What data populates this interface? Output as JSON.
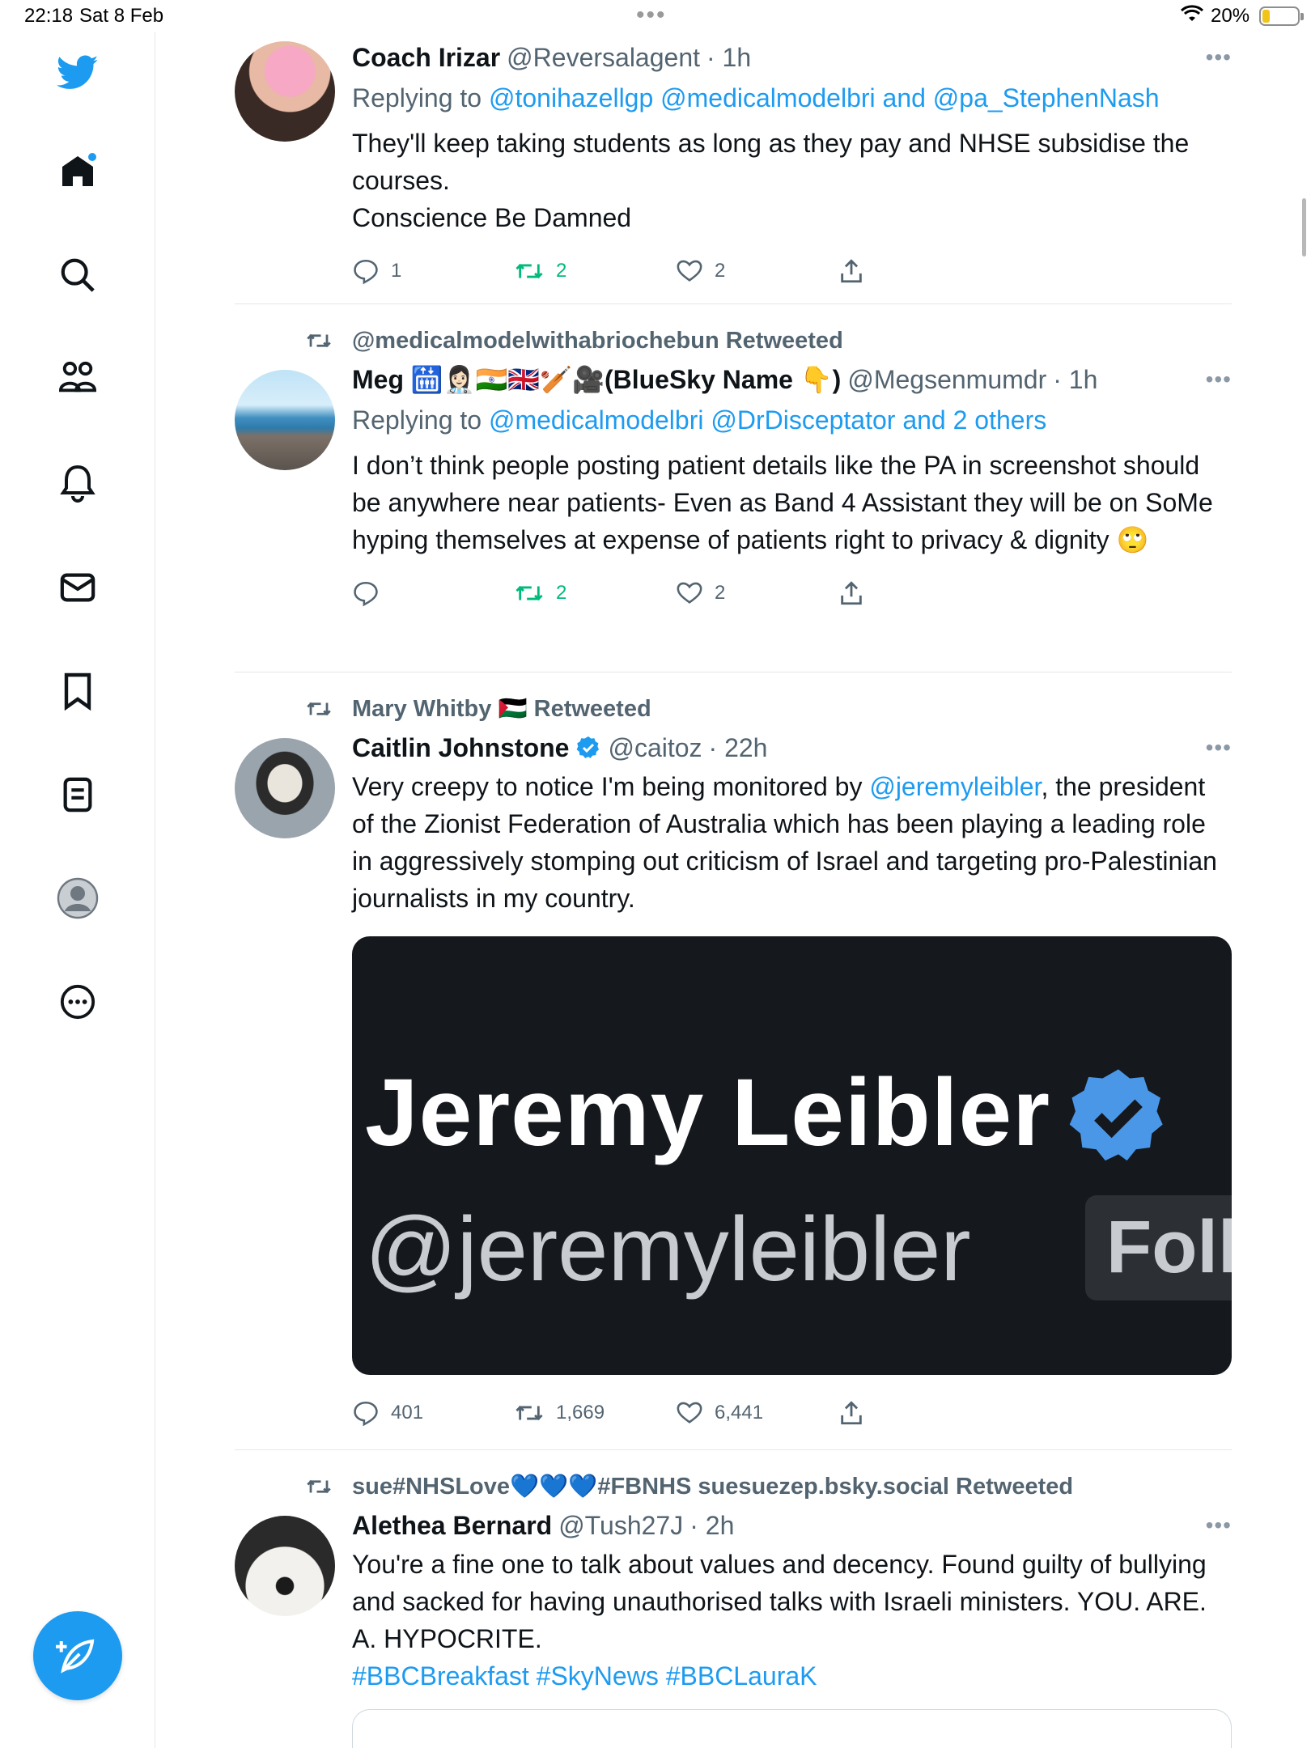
{
  "status_bar": {
    "time": "22:18",
    "date": "Sat 8 Feb",
    "battery": "20%"
  },
  "sidebar": {
    "items": [
      "twitter-logo",
      "home-icon",
      "search-icon",
      "communities-icon",
      "notifications-icon",
      "messages-icon",
      "bookmarks-icon",
      "lists-icon",
      "profile-icon",
      "more-icon"
    ],
    "compose": "compose-tweet"
  },
  "tweets": [
    {
      "name": "Coach Irizar",
      "handle": "@Reversalagent",
      "time": "· 1h",
      "replying_prefix": "Replying to",
      "replying_to": "@tonihazellgp @medicalmodelbri and @pa_StephenNash",
      "body_lines": [
        "They'll keep taking students as long as they pay and NHSE subsidise the courses.",
        "Conscience Be Damned"
      ],
      "replies": "1",
      "retweets": "2",
      "likes": "2"
    },
    {
      "retweeted_by": "@medicalmodelwithabriochebun Retweeted",
      "name": "Meg 🛗👩🏻‍⚕️🇮🇳🇬🇧🏏🎥(BlueSky Name 👇)",
      "handle": "@Megsenmumdr",
      "time": "· 1h",
      "replying_prefix": "Replying to",
      "replying_to": "@medicalmodelbri @DrDisceptator and 2 others",
      "body": "I don’t think people posting patient details like the PA in screenshot should be anywhere near patients- Even as Band 4 Assistant they will be on SoMe hyping themselves at expense of patients right to privacy & dignity 🙄",
      "replies": "",
      "retweets": "2",
      "likes": "2"
    },
    {
      "retweeted_by": "Mary Whitby 🇵🇸 Retweeted",
      "name": "Caitlin Johnstone",
      "handle": "@caitoz",
      "time": "· 22h",
      "body_prefix": "Very creepy to notice I'm being monitored by ",
      "body_link": "@jeremyleibler",
      "body_suffix": ", the president of the Zionist Federation of Australia which has been playing a leading role in aggressively stomping out criticism of Israel and targeting pro-Palestinian journalists in my country.",
      "media_name": "Jeremy Leibler",
      "media_handle": "@jeremyleibler",
      "media_button": "Foll",
      "replies": "401",
      "retweets": "1,669",
      "likes": "6,441"
    },
    {
      "retweeted_by": "sue#NHSLove💙💙💙#FBNHS suesuezep.bsky.social Retweeted",
      "name": "Alethea Bernard",
      "handle": "@Tush27J",
      "time": "· 2h",
      "body": "You're a fine one to talk about values and decency. Found guilty of bullying and sacked for having unauthorised talks with Israeli ministers. YOU. ARE. A. HYPOCRITE.",
      "hashtags": "#BBCBreakfast #SkyNews #BBCLauraK"
    }
  ],
  "colors": {
    "accent": "#1d9bf0",
    "retweet_green": "#00ba7c",
    "secondary_text": "#536471"
  }
}
